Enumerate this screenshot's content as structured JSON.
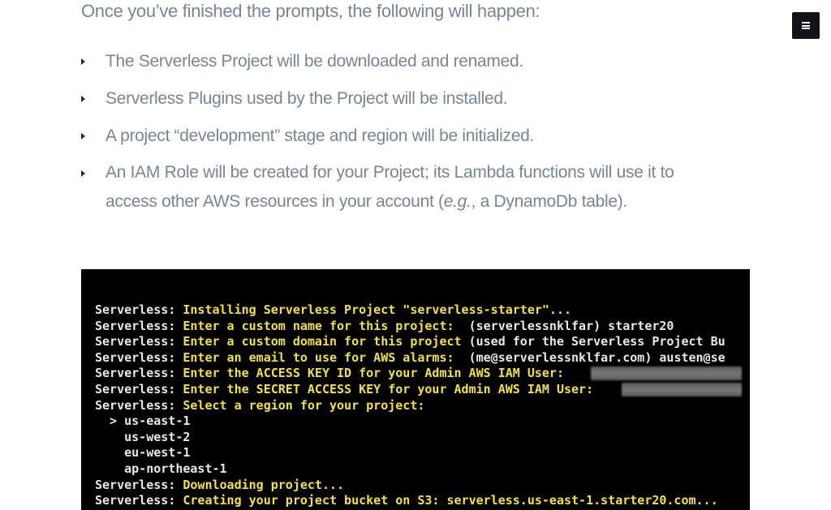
{
  "intro": "Once you’ve finished the prompts, the following will happen:",
  "bullets": [
    {
      "line1": "The Serverless Project will be downloaded and renamed."
    },
    {
      "line1": "Serverless Plugins used by the Project will be installed."
    },
    {
      "line1": "A project “development” stage and region will be initialized."
    },
    {
      "line1": "An IAM Role will be created for your Project; its Lambda functions will use it to",
      "line2_before": "access other AWS resources in your account (",
      "line2_em": "e.g.",
      "line2_after": ", a DynamoDb table)."
    }
  ],
  "terminal": {
    "lines": [
      {
        "prefix": "Serverless: ",
        "msg": "Installing Serverless Project \"serverless-starter\"...",
        "val": ""
      },
      {
        "prefix": "Serverless: ",
        "msg": "Enter a custom name for this project:",
        "val": "  (serverlessnklfar) starter20"
      },
      {
        "prefix": "Serverless: ",
        "msg": "Enter a custom domain for this project",
        "val": " (used for the Serverless Project Bu"
      },
      {
        "prefix": "Serverless: ",
        "msg": "Enter an email to use for AWS alarms:",
        "val": "  (me@serverlessnklfar.com) austen@se"
      },
      {
        "prefix": "Serverless: ",
        "msg": "Enter the ACCESS KEY ID for your Admin AWS IAM User:",
        "val": ""
      },
      {
        "prefix": "Serverless: ",
        "msg": "Enter the SECRET ACCESS KEY for your Admin AWS IAM User:",
        "val": ""
      },
      {
        "prefix": "Serverless: ",
        "msg": "Select a region for your project:",
        "val": ""
      },
      {
        "prefix": "",
        "msg": "",
        "val": "  > us-east-1"
      },
      {
        "prefix": "",
        "msg": "",
        "val": "    us-west-2"
      },
      {
        "prefix": "",
        "msg": "",
        "val": "    eu-west-1"
      },
      {
        "prefix": "",
        "msg": "",
        "val": "    ap-northeast-1"
      },
      {
        "prefix": "Serverless: ",
        "msg": "Downloading project...",
        "val": ""
      },
      {
        "prefix": "Serverless: ",
        "msg": "Creating your project bucket on S3: serverless.us-east-1.starter20.com...",
        "val": ""
      }
    ]
  },
  "colors": {
    "text": "#76869a",
    "terminal_bg": "#000000",
    "terminal_prefix": "#e8e8e8",
    "terminal_msg": "#f3e043",
    "menu_bg": "#111317"
  },
  "icons": {
    "menu": "hamburger-menu-icon",
    "bullet": "caret-right-icon"
  }
}
